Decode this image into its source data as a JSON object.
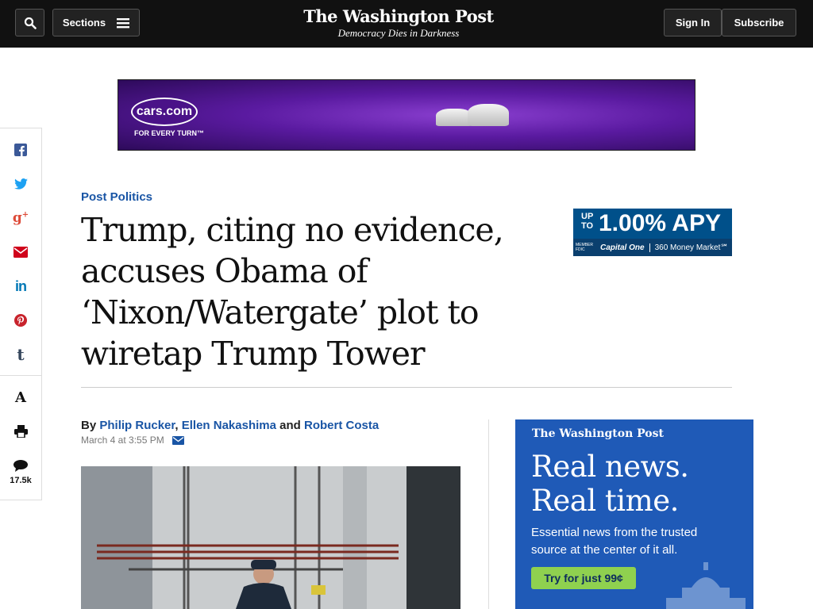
{
  "nav": {
    "sections_label": "Sections",
    "logo": "The Washington Post",
    "tagline": "Democracy Dies in Darkness",
    "signin_label": "Sign In",
    "subscribe_label": "Subscribe"
  },
  "banner_ad": {
    "brand": "cars.com",
    "tagline": "FOR EVERY TURN™"
  },
  "share_rail": {
    "items": [
      "facebook-icon",
      "twitter-icon",
      "google-plus-icon",
      "email-icon",
      "linkedin-icon",
      "pinterest-icon",
      "tumblr-icon",
      "font-size-icon",
      "print-icon",
      "comments-icon"
    ],
    "comments_count": "17.5k"
  },
  "article": {
    "kicker": "Post Politics",
    "headline": "Trump, citing no evidence, accuses Obama of ‘Nixon/Watergate’ plot to wiretap Trump Tower",
    "byline_prefix": "By",
    "authors": [
      "Philip Rucker",
      "Ellen Nakashima",
      "Robert Costa"
    ],
    "byline_sep1": ",",
    "byline_sep2": "and",
    "date": "March 4 at 3:55 PM"
  },
  "small_ad": {
    "upto": "UP TO",
    "rate": "1.00% APY",
    "fdic": "MEMBER FDIC",
    "bank": "Capital One",
    "product": "360 Money Market℠"
  },
  "wapo_ad": {
    "logo": "The Washington Post",
    "headline_line1": "Real news.",
    "headline_line2": "Real time.",
    "sub": "Essential news from the trusted source at the center of it all.",
    "cta": "Try for just 99¢"
  },
  "colors": {
    "nav_bg": "#111111",
    "link_blue": "#1955a5",
    "ad_blue": "#1f5ab7",
    "cta_green": "#8fd14f"
  }
}
